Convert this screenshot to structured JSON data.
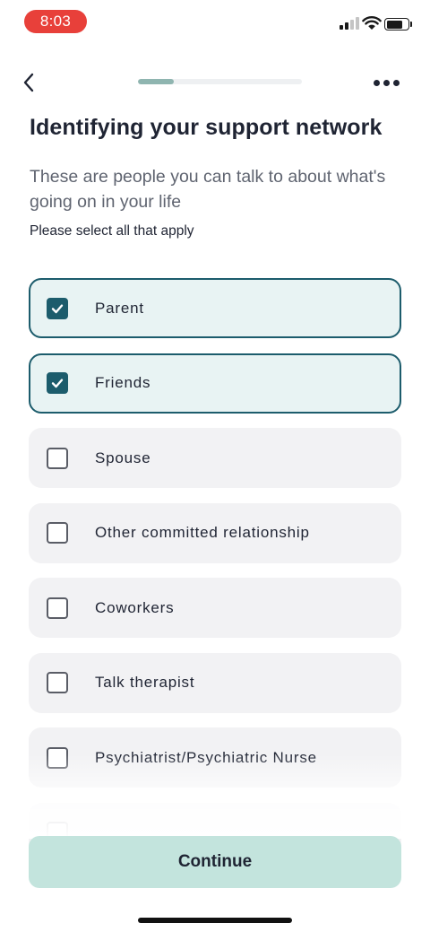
{
  "status_bar": {
    "time": "8:03",
    "signal_bars_on": 2,
    "signal_bars_total": 4,
    "battery_level": 0.78
  },
  "nav": {
    "back_icon": "chevron-left-icon",
    "more_icon": "more-horizontal-icon",
    "progress": 0.22
  },
  "header": {
    "title": "Identifying your support network",
    "subtitle": "These are people you can talk to about what's going on in your life",
    "instruction": "Please select all that apply"
  },
  "options": [
    {
      "label": "Parent",
      "selected": true
    },
    {
      "label": "Friends",
      "selected": true
    },
    {
      "label": "Spouse",
      "selected": false
    },
    {
      "label": "Other committed relationship",
      "selected": false
    },
    {
      "label": "Coworkers",
      "selected": false
    },
    {
      "label": "Talk therapist",
      "selected": false
    },
    {
      "label": "Psychiatrist/Psychiatric Nurse",
      "selected": false
    },
    {
      "label": "",
      "selected": false
    }
  ],
  "footer": {
    "continue_label": "Continue"
  },
  "colors": {
    "accent": "#1c5c6c",
    "selected_bg": "#e8f3f3",
    "option_bg": "#f2f2f4",
    "button_bg": "#c3e4dd",
    "progress_fill": "#8fb5b0",
    "time_pill": "#e8403a"
  }
}
